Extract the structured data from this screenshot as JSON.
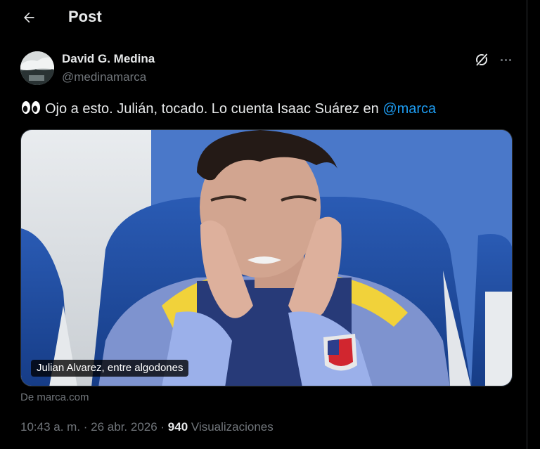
{
  "header": {
    "title": "Post",
    "back_icon": "arrow-left-icon"
  },
  "author": {
    "name": "David G. Medina",
    "handle": "@medinamarca",
    "avatar": "avatar"
  },
  "actions": {
    "grok_icon": "grok-icon",
    "more_icon": "more-icon"
  },
  "tweet": {
    "emoji": "eyes-emoji",
    "text": "Ojo a esto. Julián, tocado. Lo cuenta Isaac Suárez en ",
    "mention": "@marca"
  },
  "media": {
    "caption": "Julian Alvarez, entre algodones",
    "source": "De marca.com"
  },
  "meta": {
    "time_date": "10:43 a. m. · 26 abr. 2026 · ",
    "views_count": "940",
    "views_label": " Visualizaciones"
  },
  "colors": {
    "background": "#000000",
    "text": "#e7e9ea",
    "muted": "#71767b",
    "link": "#1d9bf0",
    "border": "#2f3336"
  }
}
